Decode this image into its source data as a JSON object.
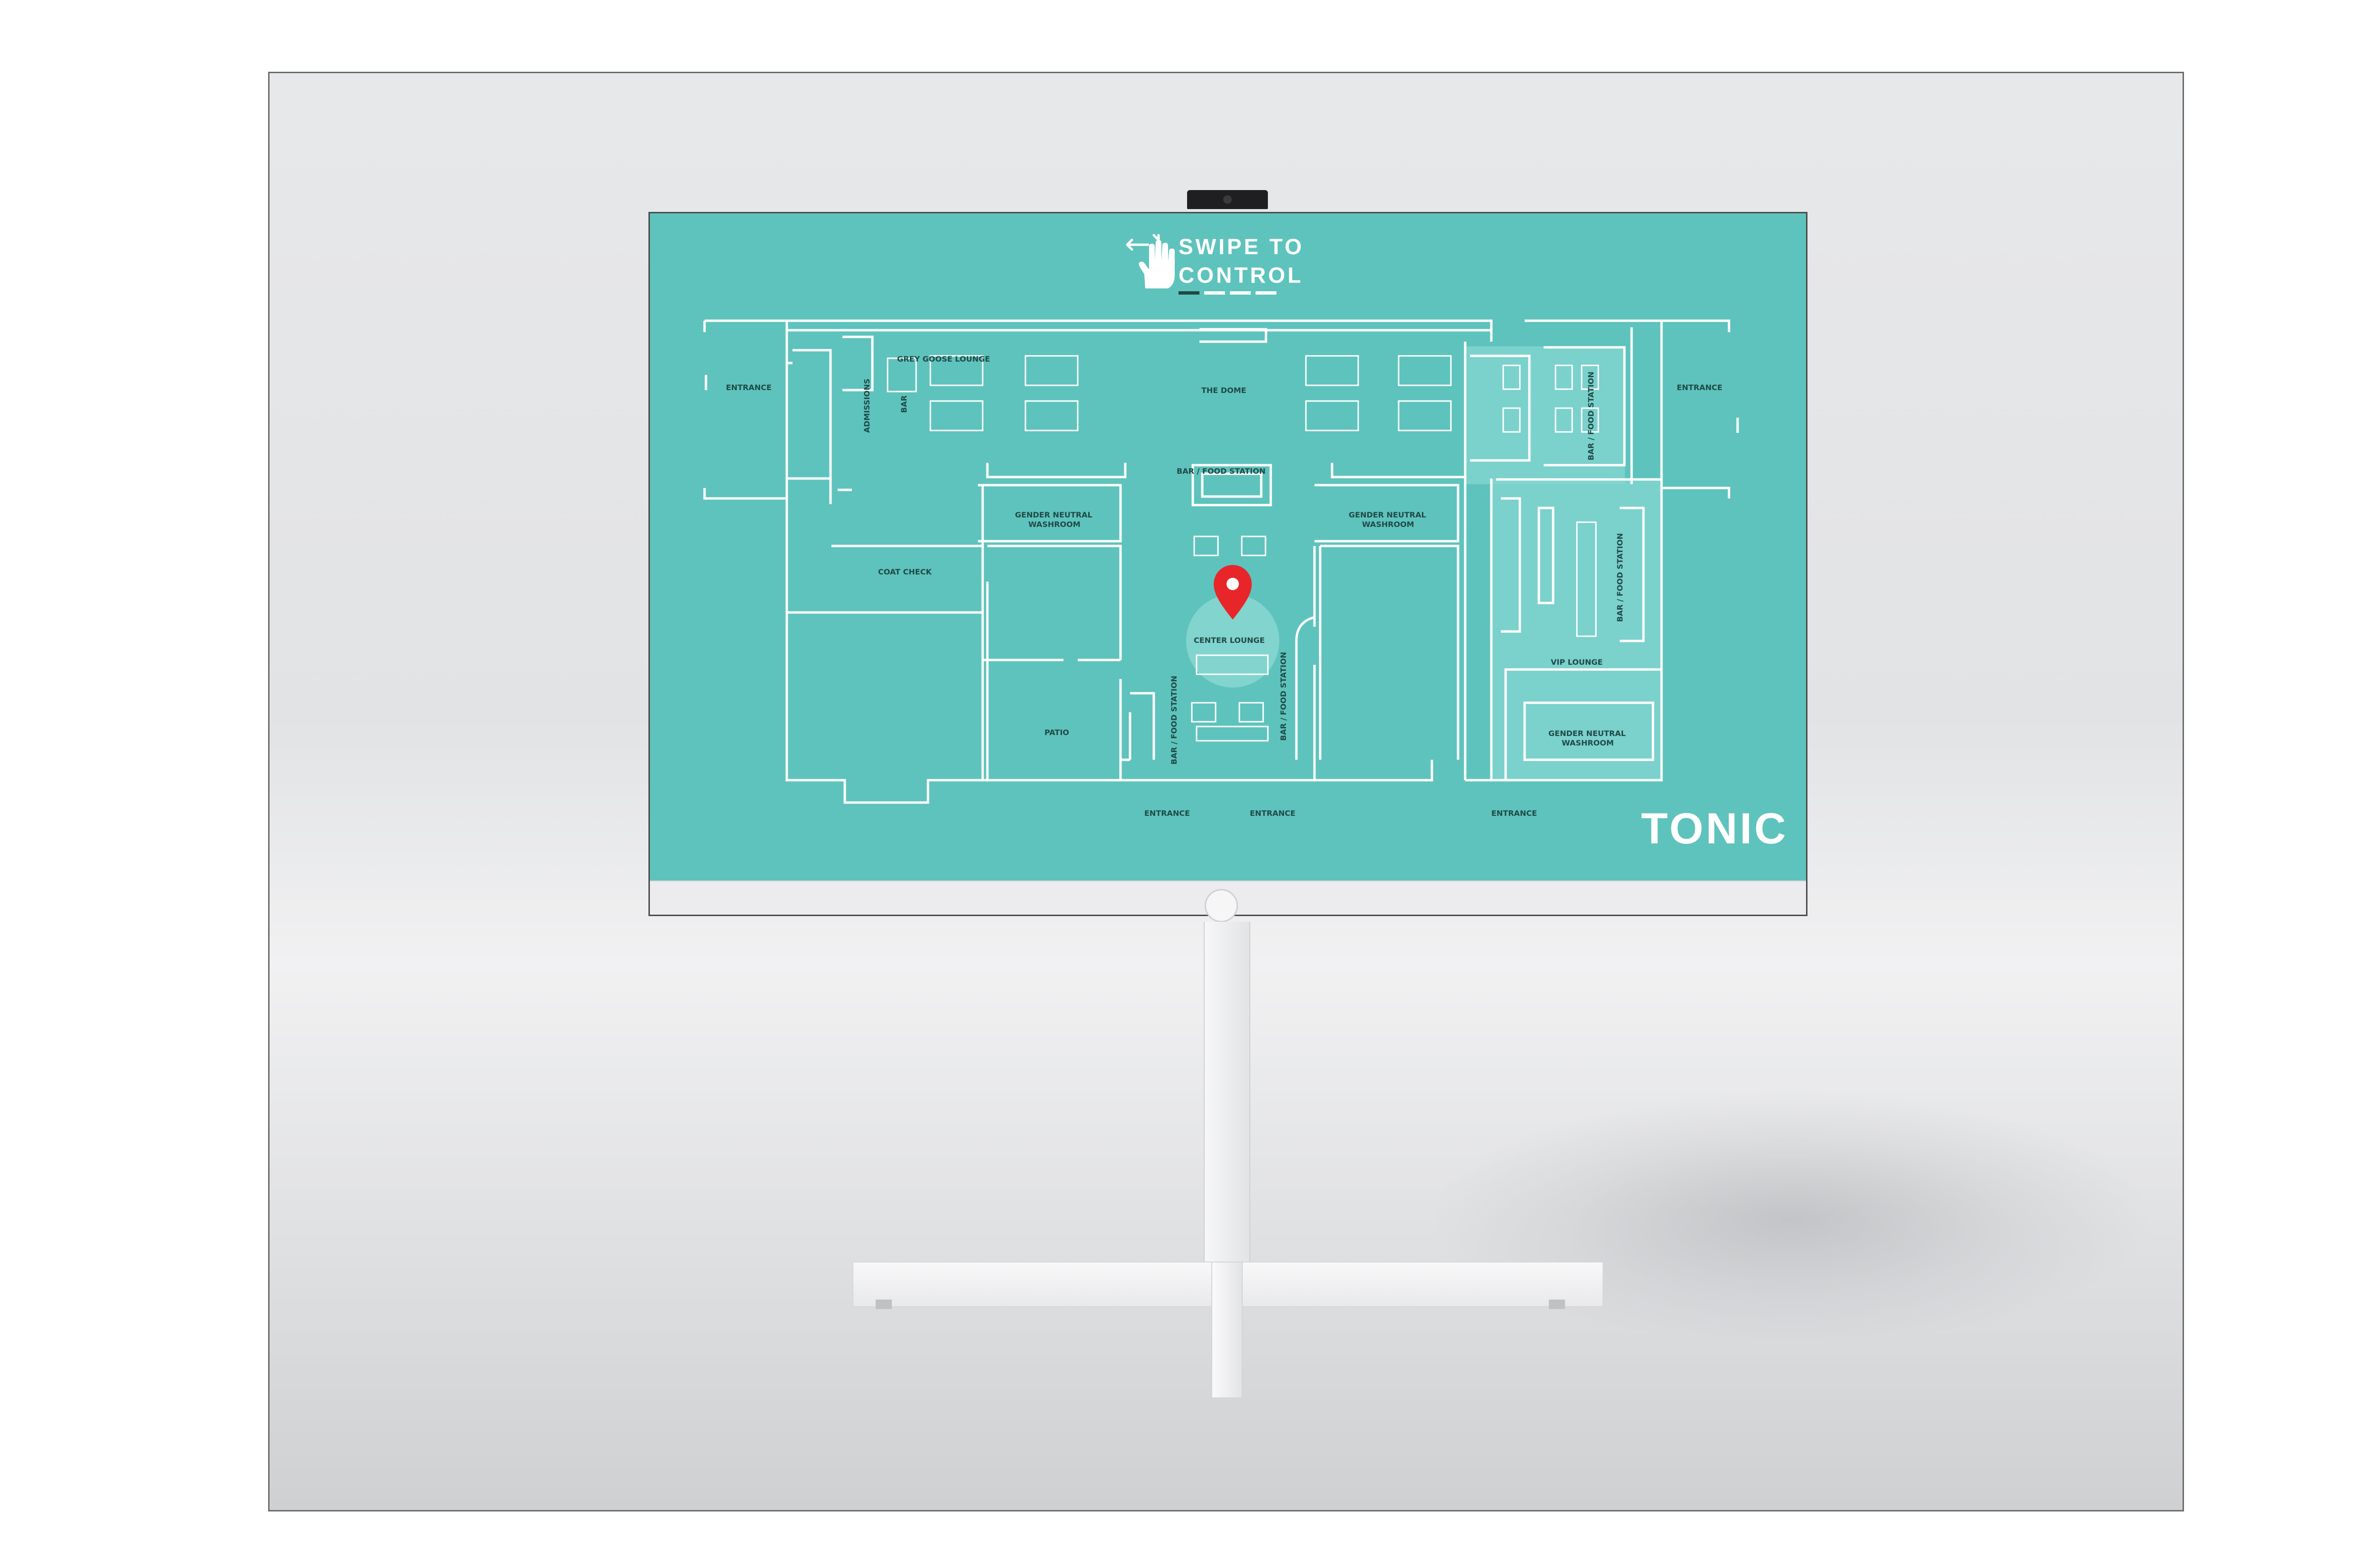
{
  "display": {
    "swipe_hint": {
      "line1": "SWIPE TO",
      "line2": "CONTROL",
      "icon": "hand-swipe-icon"
    },
    "brand": "TONIC",
    "marker_icon": "location-pin-icon"
  },
  "floorplan": {
    "labels": {
      "entrance": "ENTRANCE",
      "grey_goose_lounge": "GREY GOOSE LOUNGE",
      "bar": "BAR",
      "admissions": "ADMISSIONS",
      "the_dome": "THE DOME",
      "bar_food_station": "BAR / FOOD STATION",
      "gender_neutral_washroom_line1": "GENDER NEUTRAL",
      "gender_neutral_washroom_line2": "WASHROOM",
      "coat_check": "COAT CHECK",
      "center_lounge": "CENTER LOUNGE",
      "vip_lounge": "VIP LOUNGE",
      "patio": "PATIO"
    }
  },
  "colors": {
    "screen": "#5ec3bc",
    "lines": "#ffffff",
    "text": "#1f4a47",
    "marker": "#e8262a",
    "vip_highlight": "#86d6d1"
  }
}
